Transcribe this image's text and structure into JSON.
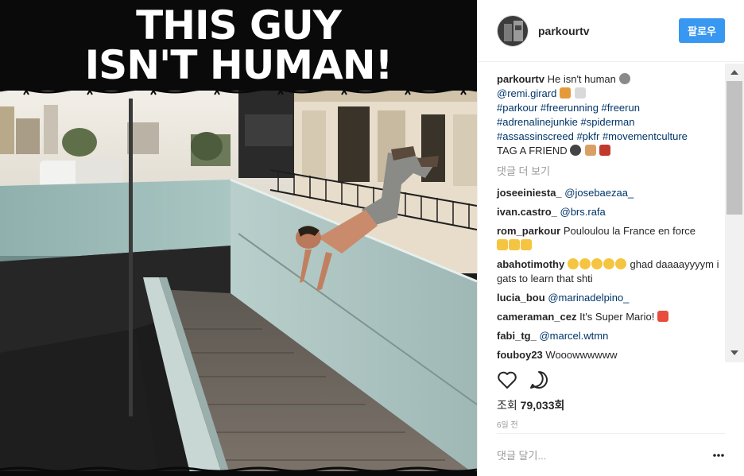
{
  "media": {
    "title_line1": "THIS GUY",
    "title_line2": "ISN'T HUMAN!"
  },
  "header": {
    "username": "parkourtv",
    "follow_label": "팔로우"
  },
  "caption": {
    "user": "parkourtv",
    "text": "He isn't human",
    "mention": "@remi.girard",
    "hashtags_1": "#parkour #freerunning #freerun",
    "hashtags_2": "#adrenalinejunkie #spiderman",
    "hashtags_3": "#assassinscreed #pkfr #movementculture",
    "tag_text": "TAG A FRIEND"
  },
  "load_more": "댓글 더 보기",
  "comments": [
    {
      "user": "joseeiniesta_",
      "mention": "@josebaezaa_",
      "text": ""
    },
    {
      "user": "ivan.castro_",
      "mention": "@brs.rafa",
      "text": ""
    },
    {
      "user": "rom_parkour",
      "mention": "",
      "text": "Pouloulou la France en force"
    },
    {
      "user": "abahotimothy",
      "mention": "",
      "text": "ghad daaaayyyym i gats to learn that shti"
    },
    {
      "user": "lucia_bou",
      "mention": "@marinadelpino_",
      "text": ""
    },
    {
      "user": "cameraman_cez",
      "mention": "",
      "text": "It's Super Mario!"
    },
    {
      "user": "fabi_tg_",
      "mention": "@marcel.wtmn",
      "text": ""
    },
    {
      "user": "fouboy23",
      "mention": "",
      "text": "Wooowwwwww"
    }
  ],
  "stats": {
    "views_label": "조회",
    "views_count": "79,033회",
    "date": "6일 전"
  },
  "add_comment_placeholder": "댓글 달기...",
  "icons": {
    "like": "heart-icon",
    "comment": "speech-bubble-icon",
    "options": "more-options-icon"
  },
  "colors": {
    "follow_button": "#3897f0",
    "link": "#003569",
    "muted": "#999999"
  }
}
